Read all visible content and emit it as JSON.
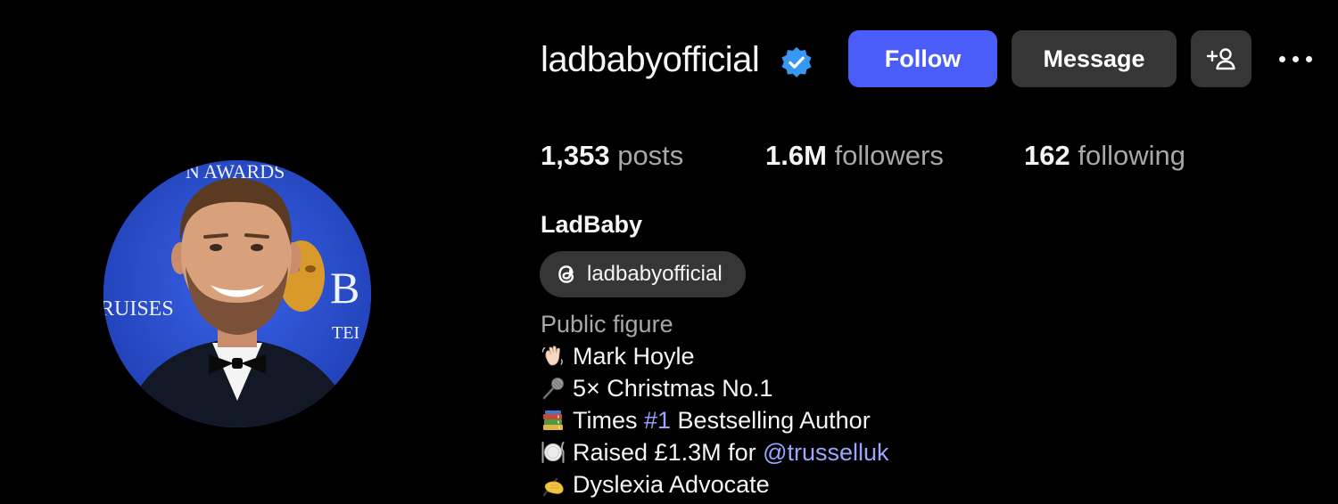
{
  "profile": {
    "username": "ladbabyofficial",
    "verified_icon": "verified-badge-icon",
    "full_name": "LadBaby",
    "category": "Public figure",
    "threads": {
      "icon": "threads-icon",
      "handle": "ladbabyofficial"
    }
  },
  "actions": {
    "follow_label": "Follow",
    "message_label": "Message",
    "add_user_icon": "add-person-icon",
    "more_icon": "more-options-icon"
  },
  "stats": {
    "posts_count": "1,353",
    "posts_label": "posts",
    "followers_count": "1.6M",
    "followers_label": "followers",
    "following_count": "162",
    "following_label": "following"
  },
  "avatar_text": {
    "banner_top": "N AWARDS",
    "banner_left": "RUISES",
    "banner_right_big": "B",
    "banner_right_small": "TEI"
  },
  "bio": {
    "lines": [
      {
        "emoji": "waving-hand-icon",
        "text": "Mark Hoyle"
      },
      {
        "emoji": "microphone-icon",
        "text": "5× Christmas No.1"
      },
      {
        "emoji": "books-icon",
        "before": "Times ",
        "link": "#1",
        "after": " Bestselling Author"
      },
      {
        "emoji": "plate-cutlery-icon",
        "before": "Raised £1.3M for ",
        "link": "@trusselluk"
      },
      {
        "emoji": "writing-hand-icon",
        "text": "Dyslexia Advocate"
      }
    ]
  },
  "colors": {
    "background": "#000000",
    "follow_button": "#4a5df9",
    "secondary_button": "#363636",
    "link": "#9aa6ff",
    "muted_text": "#a8a8a8",
    "verified_badge": "#3897f0"
  }
}
